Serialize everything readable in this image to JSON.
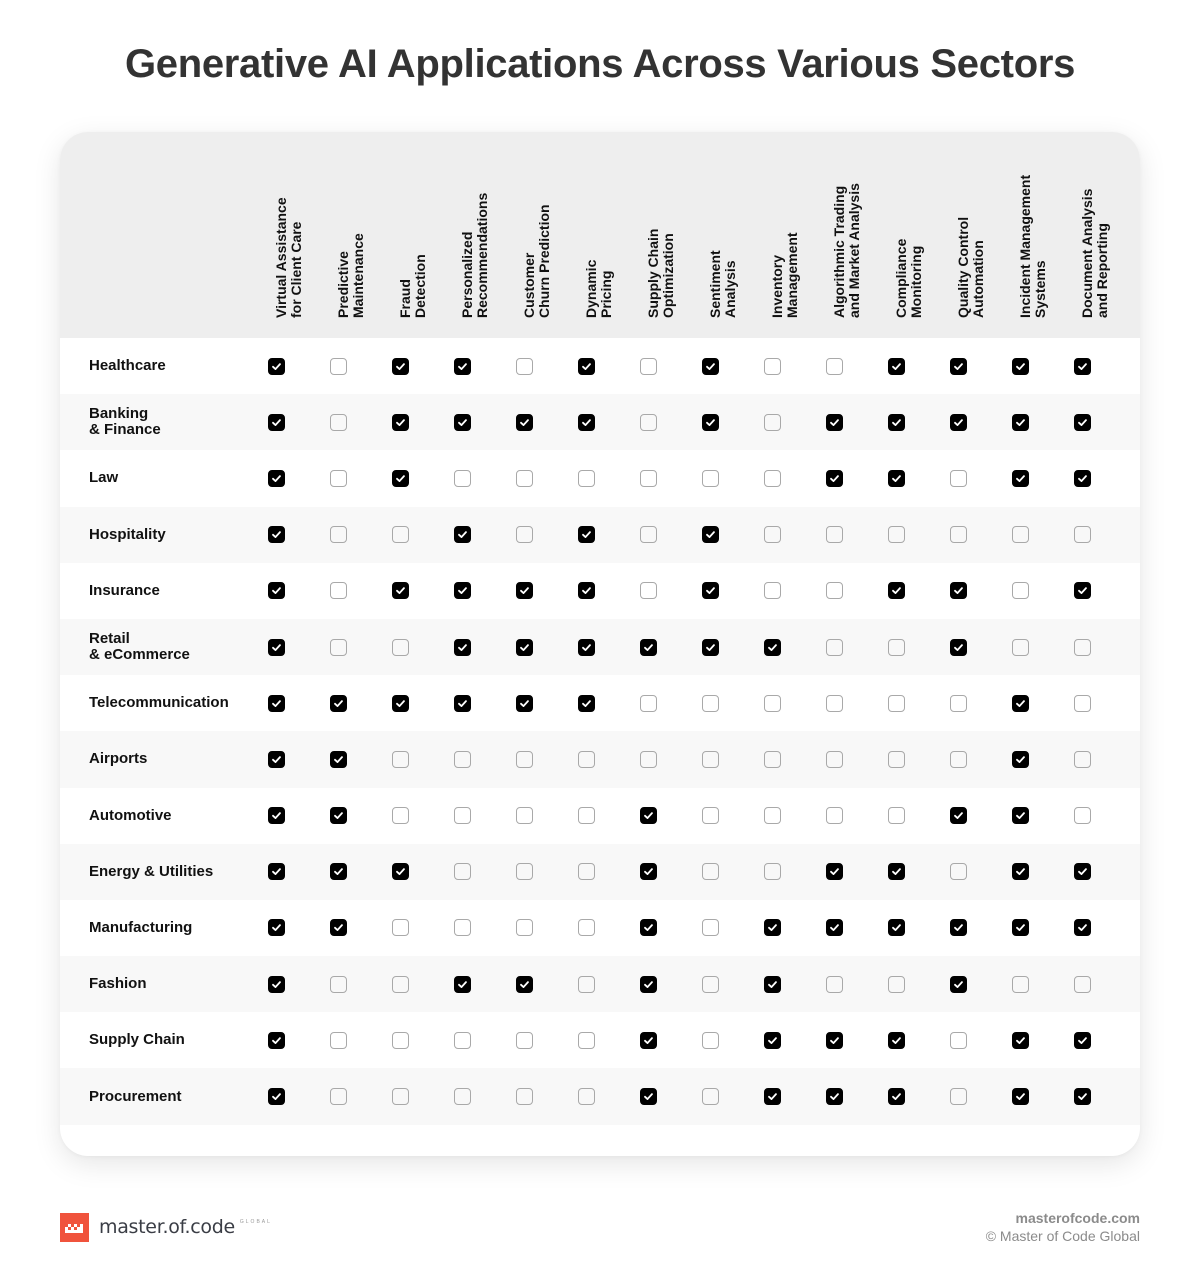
{
  "title": "Generative AI Applications Across Various Sectors",
  "columns": [
    "Virtual Assistance\nfor Client Care",
    "Predictive\nMaintenance",
    "Fraud\nDetection",
    "Personalized\nRecommendations",
    "Customer\nChurn Prediction",
    "Dynamic\nPricing",
    "Supply Chain\nOptimization",
    "Sentiment\nAnalysis",
    "Inventory\nManagement",
    "Algorithmic Trading\nand Market Analysis",
    "Compliance\nMonitoring",
    "Quality Control\nAutomation",
    "Incident Management\nSystems",
    "Document Analysis\nand Reporting"
  ],
  "rows": [
    {
      "sector": "Healthcare",
      "checks": [
        1,
        0,
        1,
        1,
        0,
        1,
        0,
        1,
        0,
        0,
        1,
        1,
        1,
        1
      ]
    },
    {
      "sector": "Banking\n& Finance",
      "checks": [
        1,
        0,
        1,
        1,
        1,
        1,
        0,
        1,
        0,
        1,
        1,
        1,
        1,
        1
      ]
    },
    {
      "sector": "Law",
      "checks": [
        1,
        0,
        1,
        0,
        0,
        0,
        0,
        0,
        0,
        1,
        1,
        0,
        1,
        1
      ]
    },
    {
      "sector": "Hospitality",
      "checks": [
        1,
        0,
        0,
        1,
        0,
        1,
        0,
        1,
        0,
        0,
        0,
        0,
        0,
        0
      ]
    },
    {
      "sector": "Insurance",
      "checks": [
        1,
        0,
        1,
        1,
        1,
        1,
        0,
        1,
        0,
        0,
        1,
        1,
        0,
        1
      ]
    },
    {
      "sector": "Retail\n& eCommerce",
      "checks": [
        1,
        0,
        0,
        1,
        1,
        1,
        1,
        1,
        1,
        0,
        0,
        1,
        0,
        0
      ]
    },
    {
      "sector": "Telecommunication",
      "checks": [
        1,
        1,
        1,
        1,
        1,
        1,
        0,
        0,
        0,
        0,
        0,
        0,
        1,
        0
      ]
    },
    {
      "sector": "Airports",
      "checks": [
        1,
        1,
        0,
        0,
        0,
        0,
        0,
        0,
        0,
        0,
        0,
        0,
        1,
        0
      ]
    },
    {
      "sector": "Automotive",
      "checks": [
        1,
        1,
        0,
        0,
        0,
        0,
        1,
        0,
        0,
        0,
        0,
        1,
        1,
        0
      ]
    },
    {
      "sector": "Energy & Utilities",
      "checks": [
        1,
        1,
        1,
        0,
        0,
        0,
        1,
        0,
        0,
        1,
        1,
        0,
        1,
        1
      ]
    },
    {
      "sector": "Manufacturing",
      "checks": [
        1,
        1,
        0,
        0,
        0,
        0,
        1,
        0,
        1,
        1,
        1,
        1,
        1,
        1
      ]
    },
    {
      "sector": "Fashion",
      "checks": [
        1,
        0,
        0,
        1,
        1,
        0,
        1,
        0,
        1,
        0,
        0,
        1,
        0,
        0
      ]
    },
    {
      "sector": "Supply Chain",
      "checks": [
        1,
        0,
        0,
        0,
        0,
        0,
        1,
        0,
        1,
        1,
        1,
        0,
        1,
        1
      ]
    },
    {
      "sector": "Procurement",
      "checks": [
        1,
        0,
        0,
        0,
        0,
        0,
        1,
        0,
        1,
        1,
        1,
        0,
        1,
        1
      ]
    }
  ],
  "footer": {
    "brand_name": "master.of.code",
    "brand_tag": "GLOBAL",
    "logo_icon": "crown-pixel-icon",
    "site": "masterofcode.com",
    "copyright": "© Master of Code Global"
  },
  "colors": {
    "brand": "#f0533c",
    "checked": "#000000",
    "header_band": "#eeeeee"
  }
}
